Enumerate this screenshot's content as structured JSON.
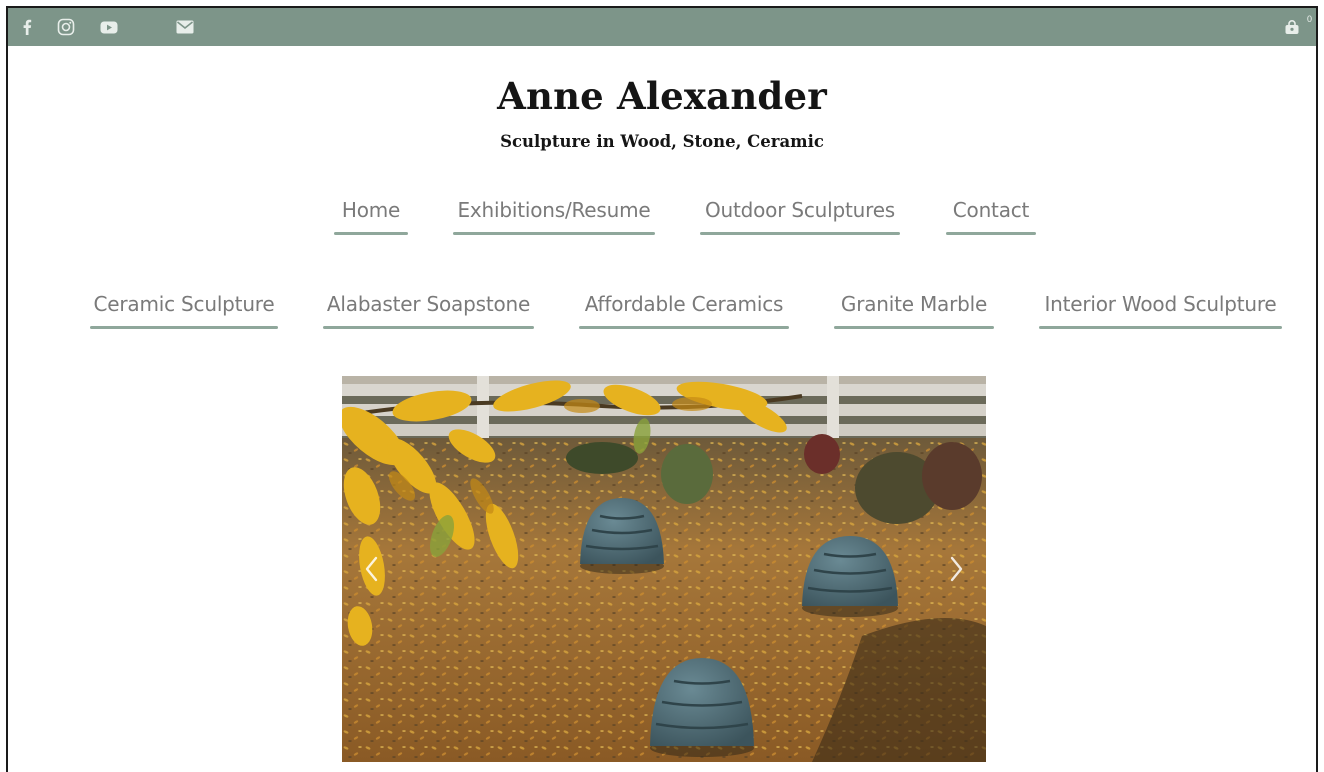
{
  "site": {
    "title": "Anne Alexander",
    "subtitle": "Sculpture in Wood, Stone, Ceramic"
  },
  "social": {
    "icons": [
      "facebook-icon",
      "instagram-icon",
      "youtube-icon",
      "email-icon"
    ]
  },
  "cart": {
    "count": "0"
  },
  "nav_primary": [
    {
      "label": "Home"
    },
    {
      "label": "Exhibitions/Resume"
    },
    {
      "label": "Outdoor Sculptures"
    },
    {
      "label": "Contact"
    }
  ],
  "nav_secondary": [
    {
      "label": "Ceramic Sculpture"
    },
    {
      "label": "Alabaster Soapstone"
    },
    {
      "label": "Affordable Ceramics"
    },
    {
      "label": "Granite Marble"
    },
    {
      "label": "Interior Wood Sculpture"
    }
  ],
  "slideshow": {
    "image": "spiral-ceramic-sculptures-in-garden"
  },
  "colors": {
    "topbar": "#7d9589",
    "underline": "#8fa79b",
    "nav_text": "#7a7a7a",
    "title_text": "#151515"
  }
}
